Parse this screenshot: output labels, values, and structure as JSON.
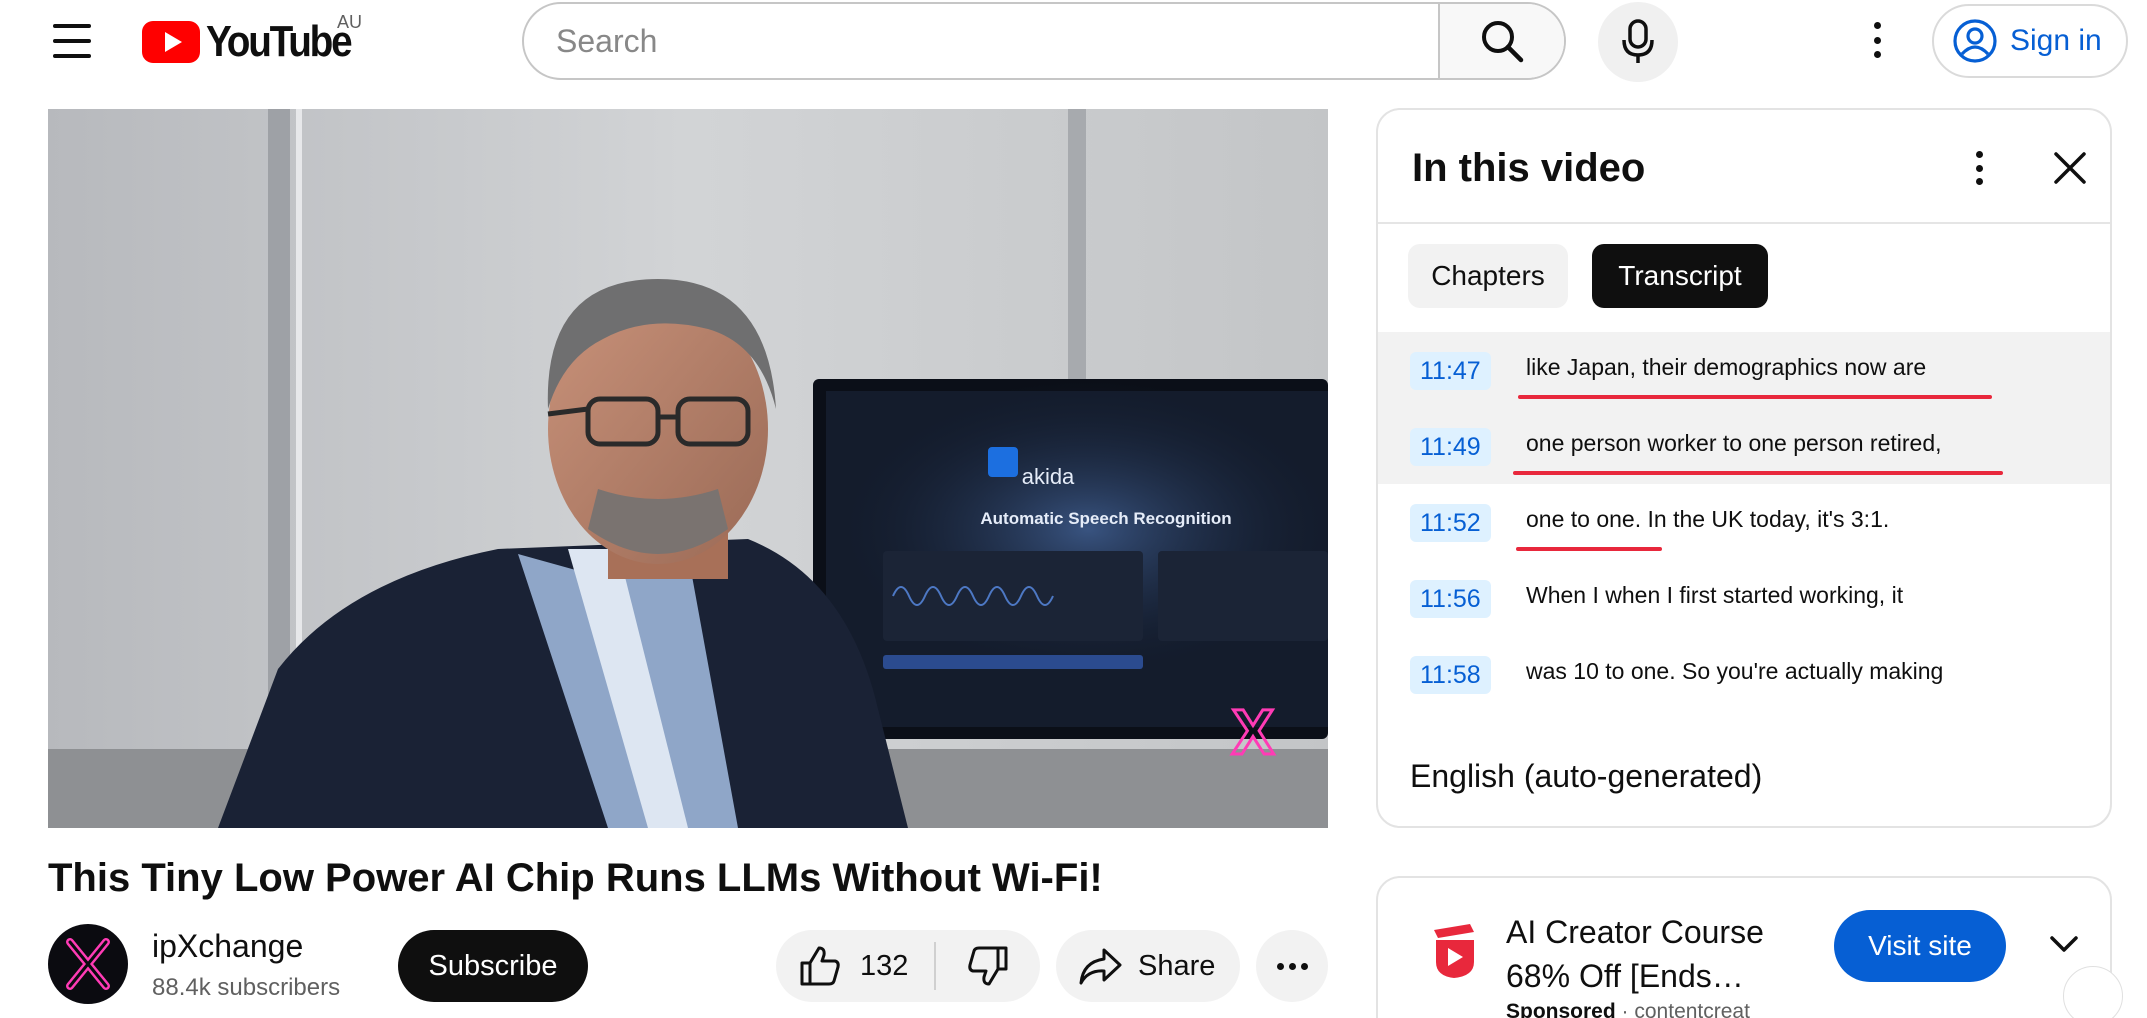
{
  "header": {
    "logo_text": "YouTube",
    "country_code": "AU",
    "search_placeholder": "Search",
    "signin_label": "Sign in",
    "colors": {
      "brand_red": "#ff0000",
      "link_blue": "#065fd4"
    }
  },
  "video": {
    "title": "This Tiny Low Power AI Chip Runs LLMs Without Wi-Fi!",
    "frame_screen_brand": "akida",
    "frame_screen_heading": "Automatic Speech Recognition"
  },
  "channel": {
    "name": "ipXchange",
    "subscribers": "88.4k subscribers",
    "subscribe_label": "Subscribe"
  },
  "actions": {
    "like_count": "132",
    "share_label": "Share"
  },
  "panel": {
    "title": "In this video",
    "tabs": [
      {
        "label": "Chapters",
        "selected": false
      },
      {
        "label": "Transcript",
        "selected": true
      }
    ],
    "segments": [
      {
        "time": "11:47",
        "text": "like Japan, their demographics now are",
        "active": true
      },
      {
        "time": "11:49",
        "text": "one person worker to one person retired,",
        "active": true
      },
      {
        "time": "11:52",
        "text": "one to one. In the UK today, it's 3:1.",
        "active": false
      },
      {
        "time": "11:56",
        "text": "When I when I first started working, it",
        "active": false
      },
      {
        "time": "11:58",
        "text": "was 10 to one. So you're actually making",
        "active": false
      }
    ],
    "language": "English (auto-generated)",
    "annotation_color": "#e8283c"
  },
  "ad": {
    "title": "AI Creator Course 68% Off [Ends…",
    "sponsored_label": "Sponsored",
    "separator": "·",
    "advertiser": "contentcreat",
    "cta_label": "Visit site"
  }
}
